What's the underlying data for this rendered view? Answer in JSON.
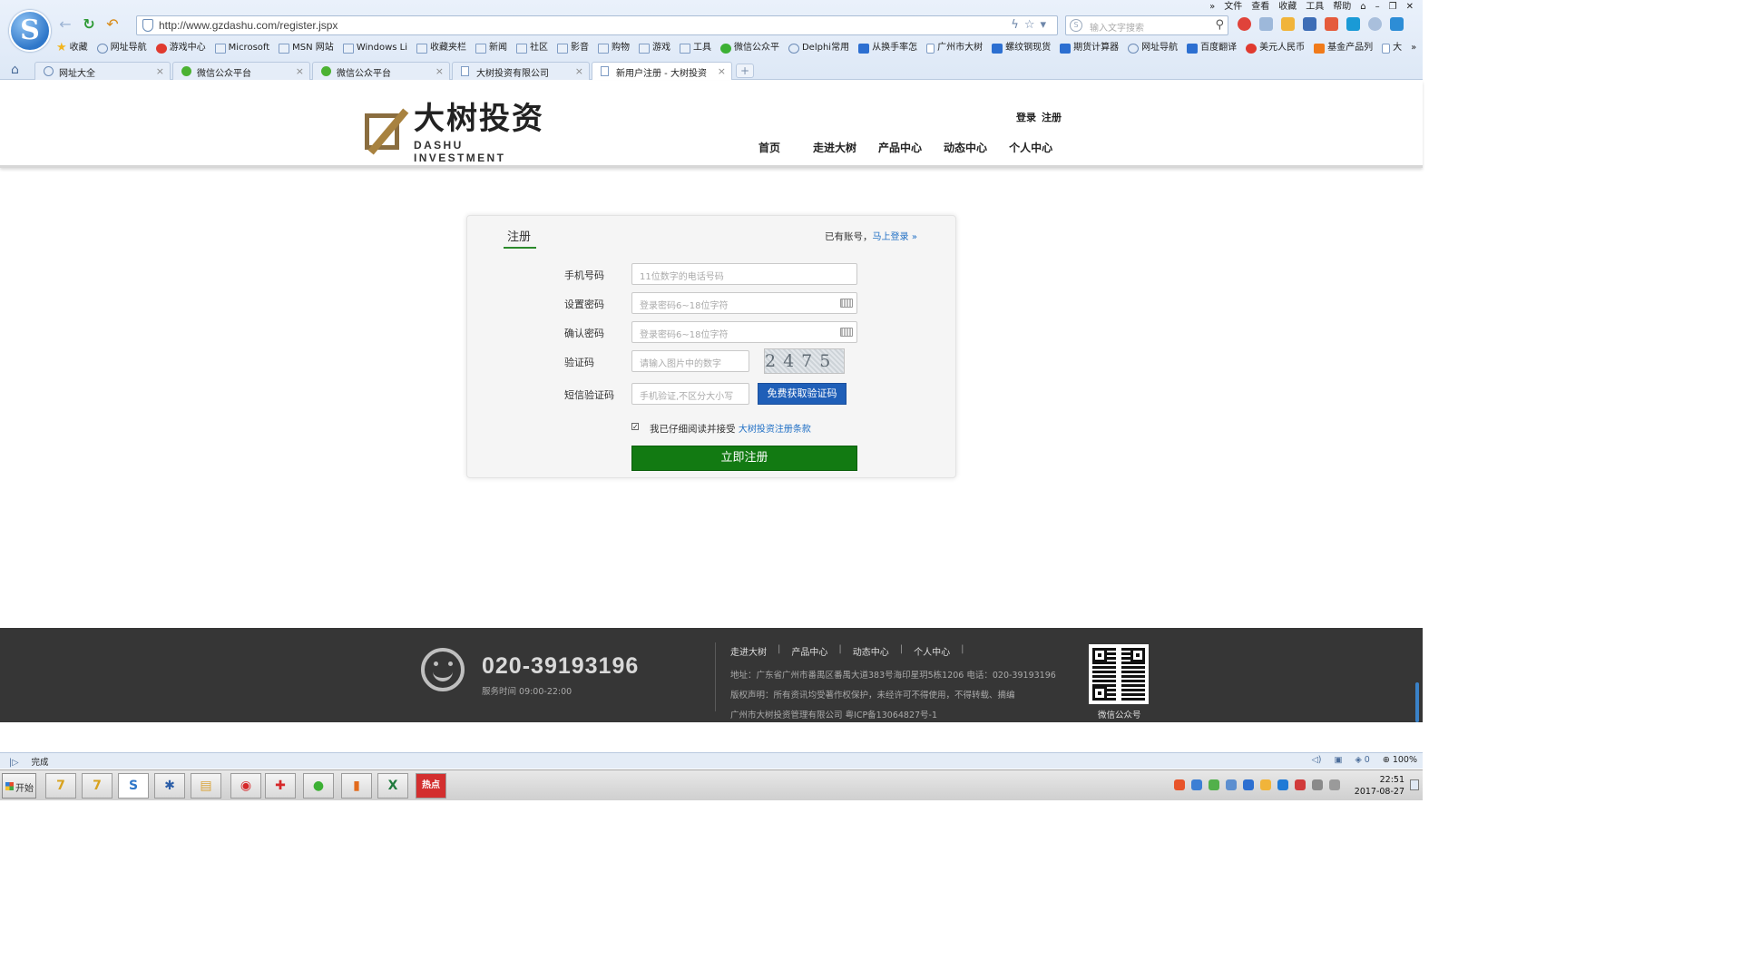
{
  "browser": {
    "menu": [
      "»",
      "文件",
      "查看",
      "收藏",
      "工具",
      "帮助"
    ],
    "url": "http://www.gzdashu.com/register.jspx",
    "search_placeholder": "输入文字搜索",
    "favorites": [
      {
        "label": "收藏",
        "icon": "star-icon"
      },
      {
        "label": "网址导航",
        "icon": "globe-icon"
      },
      {
        "label": "游戏中心",
        "icon": "game-icon"
      },
      {
        "label": "Microsoft",
        "icon": "folder-icon"
      },
      {
        "label": "MSN 网站",
        "icon": "folder-icon"
      },
      {
        "label": "Windows Li",
        "icon": "folder-icon"
      },
      {
        "label": "收藏夹栏",
        "icon": "folder-icon"
      },
      {
        "label": "新闻",
        "icon": "folder-icon"
      },
      {
        "label": "社区",
        "icon": "folder-icon"
      },
      {
        "label": "影音",
        "icon": "folder-icon"
      },
      {
        "label": "购物",
        "icon": "folder-icon"
      },
      {
        "label": "游戏",
        "icon": "folder-icon"
      },
      {
        "label": "工具",
        "icon": "folder-icon"
      },
      {
        "label": "微信公众平",
        "icon": "wechat-icon"
      },
      {
        "label": "Delphi常用",
        "icon": "delphi-icon"
      },
      {
        "label": "从换手率怎",
        "icon": "app-icon"
      },
      {
        "label": "广州市大树",
        "icon": "page-icon"
      },
      {
        "label": "螺纹钢现货",
        "icon": "app-icon"
      },
      {
        "label": "期货计算器",
        "icon": "app-icon"
      },
      {
        "label": "网址导航",
        "icon": "globe-icon"
      },
      {
        "label": "百度翻译",
        "icon": "translate-icon"
      },
      {
        "label": "美元人民币",
        "icon": "weibo-icon"
      },
      {
        "label": "基金产品列",
        "icon": "fund-icon"
      },
      {
        "label": "大",
        "icon": "page-icon"
      }
    ],
    "tabs": [
      {
        "label": "网址大全",
        "icon": "globe-icon",
        "active": false
      },
      {
        "label": "微信公众平台",
        "icon": "wechat-icon",
        "active": false
      },
      {
        "label": "微信公众平台",
        "icon": "wechat-icon",
        "active": false
      },
      {
        "label": "大树投资有限公司",
        "icon": "page-icon",
        "active": false
      },
      {
        "label": "新用户注册 - 大树投资",
        "icon": "page-icon",
        "active": true
      }
    ],
    "close_glyph": "×",
    "new_tab_glyph": "+"
  },
  "site": {
    "logo_cn": "大树投资",
    "logo_en": "DASHU INVESTMENT",
    "login_link": "登录",
    "register_link": "注册",
    "nav": [
      "首页",
      "走进大树",
      "产品中心",
      "动态中心",
      "个人中心"
    ]
  },
  "register": {
    "title": "注册",
    "have_account": "已有账号，",
    "login_now": "马上登录",
    "login_arrow": "»",
    "fields": [
      {
        "label": "手机号码",
        "placeholder": "11位数字的电话号码"
      },
      {
        "label": "设置密码",
        "placeholder": "登录密码6~18位字符"
      },
      {
        "label": "确认密码",
        "placeholder": "登录密码6~18位字符"
      },
      {
        "label": "验证码",
        "placeholder": "请输入图片中的数字"
      },
      {
        "label": "短信验证码",
        "placeholder": "手机验证,不区分大小写"
      }
    ],
    "captcha_text": "2475",
    "sms_button": "免费获取验证码",
    "agree_checked": true,
    "agree_text": "我已仔细阅读并接受",
    "agree_link": "大树投资注册条款",
    "submit": "立即注册"
  },
  "footer": {
    "phone": "020-39193196",
    "hours": "服务时间 09:00-22:00",
    "links": [
      "走进大树",
      "产品中心",
      "动态中心",
      "个人中心"
    ],
    "address": "地址：广东省广州市番禺区番禺大道383号海印星玥5栋1206 电话：020-39193196",
    "copyright": "版权声明：所有资讯均受著作权保护，未经许可不得使用，不得转载、摘编",
    "icp": "广州市大树投资管理有限公司 粤ICP备13064827号-1",
    "qr_label": "微信公众号"
  },
  "status": {
    "text": "完成",
    "badge": "0",
    "zoom": "100%"
  },
  "taskbar": {
    "start": "开始",
    "hot_label": "热点",
    "clock_time": "22:51",
    "clock_date": "2017-08-27"
  }
}
